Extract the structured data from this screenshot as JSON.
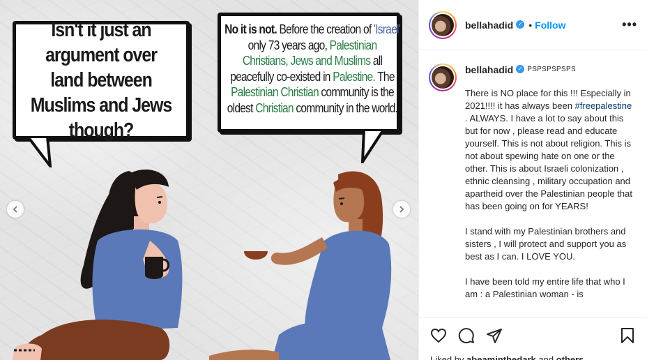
{
  "post": {
    "left_bubble_text": "Isn't it just an argument over land between Muslims and Jews though?",
    "right_bubble": {
      "bold_lead": "No it is not.",
      "s1": " Before the creation of ",
      "israel": "'Israel'",
      "s2": " only 73 years ago, ",
      "palestinian": "Palestinian",
      "s3": " ",
      "groups": "Christians, Jews and Muslims",
      "s4": " all peacefully co-existed in ",
      "palestine": "Palestine.",
      "s5": " The ",
      "pal_christian": "Palestinian Christian",
      "s6": " community is the oldest ",
      "christian": "Christian",
      "s7": " community in the world."
    },
    "nav_prev_icon": "chevron-left-icon",
    "nav_next_icon": "chevron-right-icon"
  },
  "header": {
    "username": "bellahadid",
    "separator": "•",
    "follow_label": "Follow",
    "more_label": "•••"
  },
  "caption": {
    "username": "bellahadid",
    "tag": "PSPSPSPSPS",
    "text_part1": "There is NO place for this !!! Especially in 2021!!!! it has always been ",
    "hashtag": "#freepalestine",
    "text_part2": " . ALWAYS. I have a lot to say about this but for now , please read and educate yourself. This is not about religion. This is not about spewing hate on one or the other. This is about Israeli colonization , ethnic cleansing , military occupation and apartheid over the Palestinian people that has been going on for YEARS!\n\nI stand with my Palestinian brothers and sisters , I will protect and support you as best as I can. I LOVE YOU.\n\nI have been told my entire life that who I am : a Palestinian woman - is"
  },
  "actions": {
    "liked_prefix": "Liked by ",
    "liked_user": "abeaminthedark",
    "liked_and": " and ",
    "liked_others": "others"
  },
  "colors": {
    "follow_blue": "#0095f6",
    "verified_blue": "#3897f0",
    "bubble_blue_text": "#4a69a8",
    "bubble_green_text": "#2b7d46",
    "shirt_blue": "#5b79b8"
  }
}
